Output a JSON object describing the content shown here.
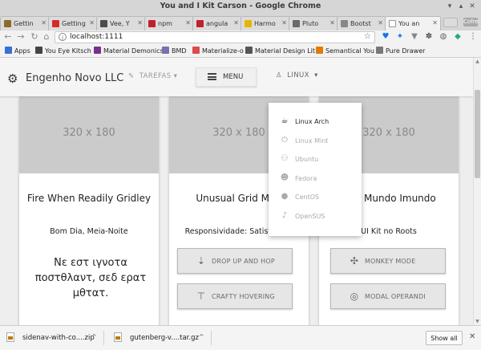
{
  "window": {
    "title": "You and I Kit Carson - Google Chrome"
  },
  "tabs": [
    {
      "label": "Gettin",
      "icon_color": "#8a6b2a"
    },
    {
      "label": "Getting",
      "icon_color": "#d52b2b"
    },
    {
      "label": "Vee, Y",
      "icon_color": "#4a4a4a"
    },
    {
      "label": "npm",
      "icon_color": "#c12127"
    },
    {
      "label": "angula",
      "icon_color": "#c12127"
    },
    {
      "label": "Harmo",
      "icon_color": "#e8b400"
    },
    {
      "label": "Pluto",
      "icon_color": "#6a6a6a"
    },
    {
      "label": "Bootst",
      "icon_color": "#888888"
    },
    {
      "label": "You an",
      "icon_color": "#ffffff"
    }
  ],
  "toolbar": {
    "url": "localhost:1111"
  },
  "bookmarks": [
    {
      "label": "Apps",
      "icon_color": "#3b6fd6"
    },
    {
      "label": "You Eye Kitsch",
      "icon_color": "#444444"
    },
    {
      "label": "Material Demonics",
      "icon_color": "#7a2f8c"
    },
    {
      "label": "BMD",
      "icon_color": "#7a6fb0"
    },
    {
      "label": "Materialize-o",
      "icon_color": "#e04a4a"
    },
    {
      "label": "Material Design Lit",
      "icon_color": "#555555"
    },
    {
      "label": "Semantical You",
      "icon_color": "#e27a00"
    },
    {
      "label": "Pure Drawer",
      "icon_color": "#777777"
    }
  ],
  "appbar": {
    "brand": "Engenho Novo LLC",
    "tarefas": "TAREFAS",
    "menu": "MENU",
    "linux": "LINUX"
  },
  "dropdown": [
    {
      "label": "Linux Arch",
      "icon": "coffee-icon",
      "glyph": "☕",
      "active": true
    },
    {
      "label": "Linux Mint",
      "icon": "power-icon",
      "glyph": "⏻",
      "active": false
    },
    {
      "label": "Ubuntu",
      "icon": "people-icon",
      "glyph": "👥",
      "active": false
    },
    {
      "label": "Fedora",
      "icon": "face-icon",
      "glyph": "☻",
      "active": false
    },
    {
      "label": "CentOS",
      "icon": "person-icon",
      "glyph": "●",
      "active": false
    },
    {
      "label": "OpenSUS",
      "icon": "mic-icon",
      "glyph": "🎙",
      "active": false
    }
  ],
  "cards": [
    {
      "placeholder": "320 x 180",
      "title": "Fire When Readily Gridley",
      "subtitle": "Bom Dia, Meia-Noite",
      "greek": "Νε εστ ιγνοτα ποστθλαντ, σεδ ερατ μθτατ."
    },
    {
      "placeholder": "320 x 180",
      "title": "Unusual Grid Marl",
      "subtitle": "Responsividade: Satisfatório",
      "buttons": [
        {
          "label": "DROP UP AND HOP",
          "icon": "drag-handle-icon",
          "glyph": "⇣"
        },
        {
          "label": "CRAFTY HOVERING",
          "icon": "align-top-icon",
          "glyph": "⊤"
        }
      ]
    },
    {
      "placeholder": "320 x 180",
      "title": "Olá, Mundo Imundo",
      "subtitle": "UI Kit no Roots",
      "buttons": [
        {
          "label": "MONKEY MODE",
          "icon": "fan-icon",
          "glyph": "✣"
        },
        {
          "label": "MODAL OPERANDI",
          "icon": "target-icon",
          "glyph": "◎"
        }
      ]
    }
  ],
  "downloads": {
    "items": [
      {
        "name": "sidenav-with-co....zip"
      },
      {
        "name": "gutenberg-v....tar.gz"
      }
    ],
    "show_all": "Show all"
  }
}
